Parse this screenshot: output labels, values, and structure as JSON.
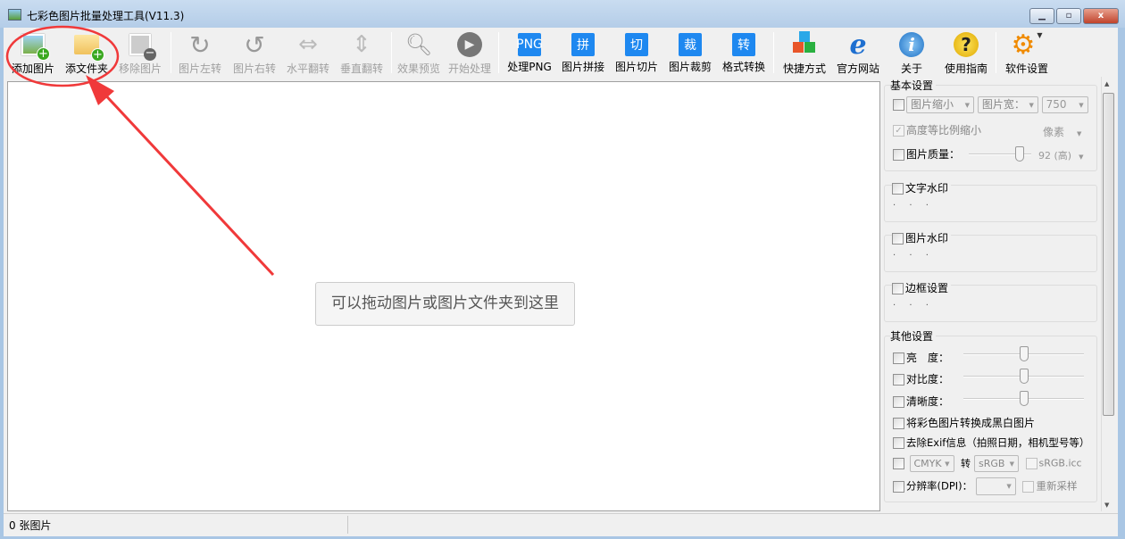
{
  "window": {
    "title": "七彩色图片批量处理工具(V11.3)",
    "min": "▁",
    "max": "▫",
    "close": "x"
  },
  "toolbar": [
    {
      "label": "添加图片",
      "icon": "add-image-icon",
      "enabled": true
    },
    {
      "label": "添文件夹",
      "icon": "add-folder-icon",
      "enabled": true
    },
    {
      "label": "移除图片",
      "icon": "remove-image-icon",
      "enabled": false
    },
    {
      "label": "图片左转",
      "icon": "rotate-left-icon",
      "enabled": false
    },
    {
      "label": "图片右转",
      "icon": "rotate-right-icon",
      "enabled": false
    },
    {
      "label": "水平翻转",
      "icon": "flip-horizontal-icon",
      "enabled": false
    },
    {
      "label": "垂直翻转",
      "icon": "flip-vertical-icon",
      "enabled": false
    },
    {
      "label": "效果预览",
      "icon": "magnifier-icon",
      "enabled": false
    },
    {
      "label": "开始处理",
      "icon": "play-icon",
      "enabled": false
    },
    {
      "label": "处理PNG",
      "icon": "png-icon",
      "glyph": "PNG",
      "enabled": true
    },
    {
      "label": "图片拼接",
      "icon": "stitch-icon",
      "glyph": "拼",
      "enabled": true
    },
    {
      "label": "图片切片",
      "icon": "slice-icon",
      "glyph": "切",
      "enabled": true
    },
    {
      "label": "图片裁剪",
      "icon": "crop-icon",
      "glyph": "裁",
      "enabled": true
    },
    {
      "label": "格式转换",
      "icon": "convert-icon",
      "glyph": "转",
      "enabled": true
    },
    {
      "label": "快捷方式",
      "icon": "shortcut-cubes-icon",
      "enabled": true
    },
    {
      "label": "官方网站",
      "icon": "ie-browser-icon",
      "enabled": true
    },
    {
      "label": "关于",
      "icon": "info-icon",
      "enabled": true
    },
    {
      "label": "使用指南",
      "icon": "help-icon",
      "enabled": true
    },
    {
      "label": "软件设置",
      "icon": "gear-icon",
      "enabled": true
    }
  ],
  "canvas": {
    "drop_hint": "可以拖动图片或图片文件夹到这里"
  },
  "status": {
    "count": "0 张图片"
  },
  "panel": {
    "basic": {
      "title": "基本设置",
      "resize_mode": "图片缩小",
      "dimension": "图片宽：",
      "size_value": "750",
      "keep_ratio": "高度等比例缩小",
      "unit": "像素",
      "quality_label": "图片质量：",
      "quality_value": "92 (高)",
      "quality_level": 92
    },
    "text_watermark": {
      "title": "文字水印",
      "dots": "· · ·"
    },
    "image_watermark": {
      "title": "图片水印",
      "dots": "· · ·"
    },
    "border": {
      "title": "边框设置",
      "dots": "· · ·"
    },
    "other": {
      "title": "其他设置",
      "brightness": "亮　度：",
      "contrast": "对比度：",
      "sharpness": "清晰度：",
      "brightness_level": 0.5,
      "contrast_level": 0.5,
      "sharpness_level": 0.5,
      "grayscale": "将彩色图片转换成黑白图片",
      "remove_exif": "去除Exif信息（拍照日期，相机型号等）",
      "color_from": "CMYK",
      "to": "转",
      "color_to": "sRGB",
      "icc": "sRGB.icc",
      "dpi": "分辨率(DPI)：",
      "resample": "重新采样"
    }
  },
  "colors": {
    "accent": "#1e88f0",
    "annotation": "#f0393a"
  }
}
